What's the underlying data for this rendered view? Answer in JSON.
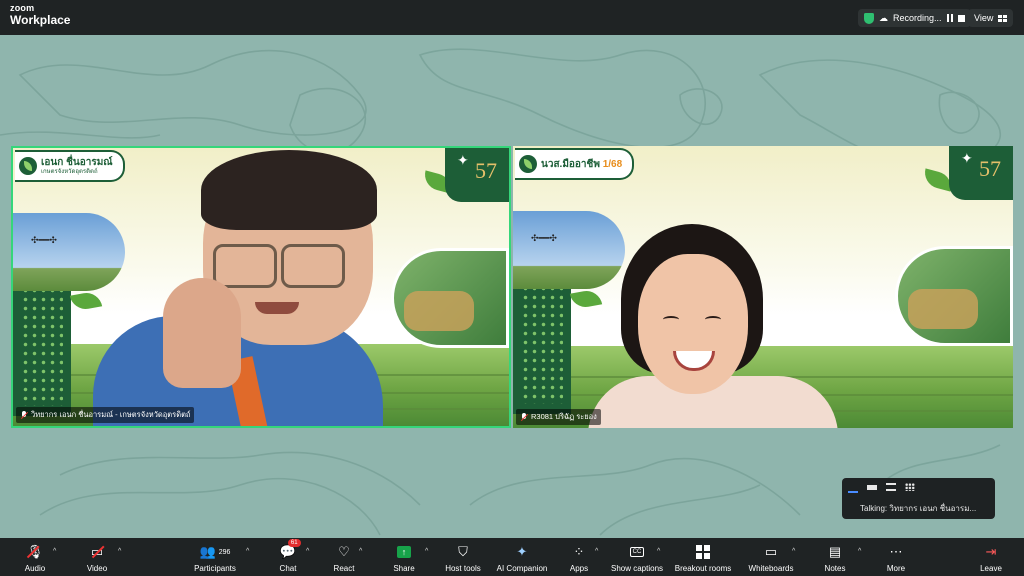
{
  "topbar": {
    "logo_top": "zoom",
    "logo_bottom": "Workplace",
    "recording_label": "Recording...",
    "view_label": "View"
  },
  "tiles": [
    {
      "banner_name": "เอนก ชื่นอารมณ์",
      "banner_sub": "เกษตรจังหวัดอุตรดิตถ์",
      "badge": "57",
      "video_label": "วิทยากร เอนก ชื่นอารมณ์ - เกษตรจังหวัดอุตรดิตถ์"
    },
    {
      "banner_name": "นวส.มืออาชีพ",
      "banner_highlight": "1/68",
      "badge": "57",
      "video_label": "R3081 ปริฉัฏ ระยอง"
    }
  ],
  "talking": {
    "text": "Talking: วิทยากร เอนก ชื่นอารม..."
  },
  "toolbar": {
    "audio": "Audio",
    "video": "Video",
    "participants": "Participants",
    "participants_count": "296",
    "chat": "Chat",
    "chat_badge": "61",
    "react": "React",
    "share": "Share",
    "host_tools": "Host tools",
    "ai_companion": "AI Companion",
    "apps": "Apps",
    "show_captions": "Show captions",
    "captions_icon": "CC",
    "breakout_rooms": "Breakout rooms",
    "whiteboards": "Whiteboards",
    "notes": "Notes",
    "more": "More",
    "leave": "Leave"
  },
  "colors": {
    "background": "#8fb5ad",
    "toolbar": "#1f2324",
    "active_speaker": "#35d67a",
    "brand_green": "#1d5e37",
    "share_green": "#17a34a",
    "badge_red": "#e22d2d"
  },
  "icons": [
    "shield-check-icon",
    "cloud-icon",
    "pause-icon",
    "stop-icon",
    "grid-view-icon",
    "mic-muted-icon",
    "video-off-icon",
    "participants-icon",
    "chat-icon",
    "heart-icon",
    "share-arrow-icon",
    "shield-icon",
    "sparkle-icon",
    "apps-icon",
    "cc-icon",
    "breakout-icon",
    "whiteboard-icon",
    "notes-icon",
    "more-icon",
    "leave-icon"
  ]
}
